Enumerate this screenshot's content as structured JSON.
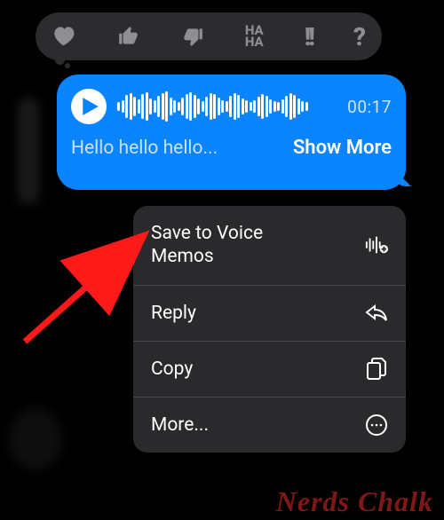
{
  "tapback": {
    "items": [
      "heart",
      "thumbs-up",
      "thumbs-down",
      "haha",
      "exclaim",
      "question"
    ]
  },
  "message": {
    "duration": "00:17",
    "transcript": "Hello hello hello...",
    "show_more": "Show More"
  },
  "menu": {
    "save": "Save to Voice Memos",
    "reply": "Reply",
    "copy": "Copy",
    "more": "More..."
  },
  "watermark": "Nerds Chalk"
}
